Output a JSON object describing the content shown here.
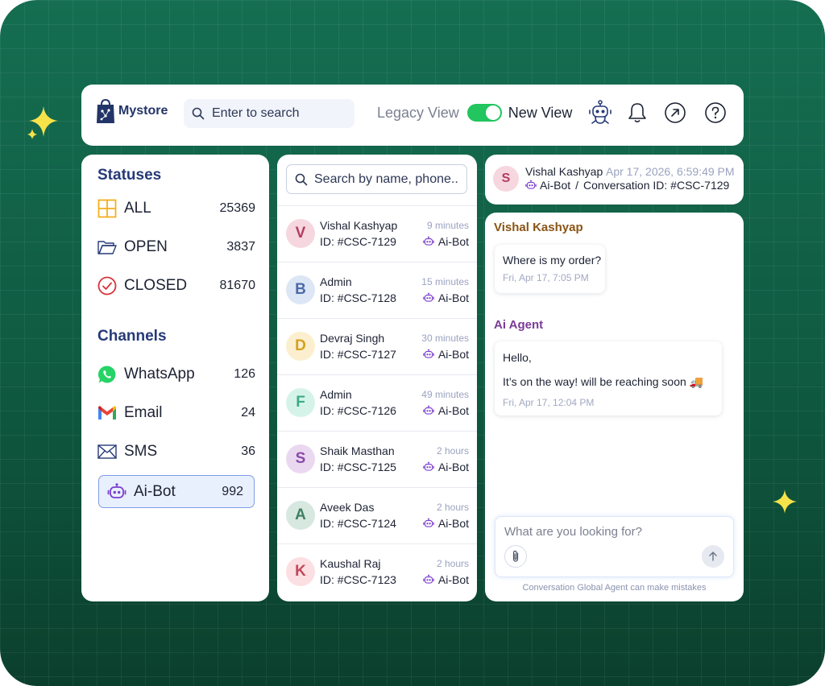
{
  "brand": {
    "name": "Mystore"
  },
  "topbar": {
    "search_placeholder": "Enter to search",
    "legacy_view_label": "Legacy View",
    "new_view_label": "New View",
    "view_toggle_on": true,
    "icons": [
      "robot-icon",
      "bell-icon",
      "external-link-icon",
      "help-icon"
    ]
  },
  "statuses": {
    "title": "Statuses",
    "items": [
      {
        "label": "ALL",
        "count": "25369",
        "icon": "grid-icon"
      },
      {
        "label": "OPEN",
        "count": "3837",
        "icon": "folder-icon"
      },
      {
        "label": "CLOSED",
        "count": "81670",
        "icon": "check-circle-icon"
      }
    ]
  },
  "channels": {
    "title": "Channels",
    "items": [
      {
        "label": "WhatsApp",
        "count": "126",
        "icon": "whatsapp-icon"
      },
      {
        "label": "Email",
        "count": "24",
        "icon": "gmail-icon"
      },
      {
        "label": "SMS",
        "count": "36",
        "icon": "envelope-icon"
      },
      {
        "label": "Ai-Bot",
        "count": "992",
        "icon": "bot-icon",
        "selected": true
      }
    ]
  },
  "conversations": {
    "search_placeholder": "Search by name, phone..",
    "items": [
      {
        "initial": "V",
        "name": "Vishal Kashyap",
        "id": "ID: #CSC-7129",
        "time": "9 minutes",
        "channel": "Ai-Bot",
        "bg": "#f6d6df",
        "fg": "#b23c62"
      },
      {
        "initial": "B",
        "name": "Admin",
        "id": "ID: #CSC-7128",
        "time": "15 minutes",
        "channel": "Ai-Bot",
        "bg": "#dde6f5",
        "fg": "#4d6aa8"
      },
      {
        "initial": "D",
        "name": "Devraj Singh",
        "id": "ID: #CSC-7127",
        "time": "30 minutes",
        "channel": "Ai-Bot",
        "bg": "#fbefcf",
        "fg": "#d5a021"
      },
      {
        "initial": "F",
        "name": "Admin",
        "id": "ID: #CSC-7126",
        "time": "49 minutes",
        "channel": "Ai-Bot",
        "bg": "#d6f3ea",
        "fg": "#3bab87"
      },
      {
        "initial": "S",
        "name": "Shaik Masthan",
        "id": "ID: #CSC-7125",
        "time": "2 hours",
        "channel": "Ai-Bot",
        "bg": "#ead8f1",
        "fg": "#8a4aa6"
      },
      {
        "initial": "A",
        "name": "Aveek Das",
        "id": "ID: #CSC-7124",
        "time": "2 hours",
        "channel": "Ai-Bot",
        "bg": "#d6e8df",
        "fg": "#3f7f62"
      },
      {
        "initial": "K",
        "name": "Kaushal Raj",
        "id": "ID: #CSC-7123",
        "time": "2 hours",
        "channel": "Ai-Bot",
        "bg": "#fbdfe2",
        "fg": "#c24659"
      }
    ]
  },
  "chat_header": {
    "initial": "S",
    "name": "Vishal Kashyap",
    "timestamp": "Apr 17, 2026, 6:59:49 PM",
    "channel": "Ai-Bot",
    "separator": "/",
    "conversation_id": "Conversation ID: #CSC-7129"
  },
  "chat": {
    "customer_name": "Vishal Kashyap",
    "customer_message": "Where is my order?",
    "customer_time": "Fri, Apr 17, 7:05 PM",
    "agent_name": "Ai Agent",
    "agent_line1": "Hello,",
    "agent_line2": "It’s on the way! will be reaching soon 🚚",
    "agent_time": "Fri, Apr 17, 12:04 PM",
    "composer_placeholder": "What are you looking for?",
    "disclaimer": "Conversation Global Agent can make mistakes"
  },
  "colors": {
    "background": "#0f5a41",
    "accent": "#263a78",
    "toggle_on": "#22c55e",
    "customer_name": "#8a5415",
    "agent_name": "#7a3a96",
    "selected_channel_bg": "#e9f0fd",
    "sparkle": "#f7e24a"
  }
}
